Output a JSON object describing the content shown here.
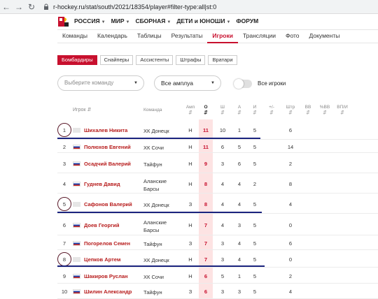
{
  "browser": {
    "url": "r-hockey.ru/stat/south/2021/18354/player#filter-type:all|st:0",
    "back_icon": "arrow-left-icon",
    "forward_icon": "arrow-right-icon",
    "reload_icon": "reload-icon"
  },
  "top_menu": [
    {
      "label": "РОССИЯ",
      "caret": true
    },
    {
      "label": "МИР",
      "caret": true
    },
    {
      "label": "СБОРНАЯ",
      "caret": true
    },
    {
      "label": "ДЕТИ и ЮНОШИ",
      "caret": true
    },
    {
      "label": "ФОРУМ",
      "caret": false
    }
  ],
  "sub_nav": [
    "Команды",
    "Календарь",
    "Таблицы",
    "Результаты",
    "Игроки",
    "Трансляции",
    "Фото",
    "Документы"
  ],
  "sub_nav_active": "Игроки",
  "filter_tabs": [
    "Бомбардиры",
    "Снайперы",
    "Ассистенты",
    "Штрафы",
    "Вратари"
  ],
  "filter_tab_active": "Бомбардиры",
  "team_select": {
    "placeholder": "Выберите команду"
  },
  "amplua_select": {
    "value": "Все амплуа"
  },
  "toggle_label": "Все игроки",
  "table": {
    "headers": {
      "player": "Игрок",
      "team": "Команда",
      "amp": "Амп",
      "o": "О",
      "sh": "Ш",
      "a": "А",
      "i": "И",
      "pm": "+/-",
      "shtr": "Штр",
      "vv": "ВВ",
      "pct_vv": "%ВВ",
      "vpi": "ВП/И"
    },
    "rows": [
      {
        "n": "1",
        "flag": "blank",
        "name": "Шихалев Никита",
        "team": "ХК Донецк",
        "amp": "Н",
        "o": "11",
        "sh": "10",
        "a": "1",
        "i": "5",
        "shtr": "6"
      },
      {
        "n": "2",
        "flag": "ru",
        "name": "Полюхов Евгений",
        "team": "ХК Сочи",
        "amp": "Н",
        "o": "11",
        "sh": "6",
        "a": "5",
        "i": "5",
        "shtr": "14"
      },
      {
        "n": "3",
        "flag": "ru",
        "name": "Осадчий Валерий",
        "team": "Тайфун",
        "amp": "Н",
        "o": "9",
        "sh": "3",
        "a": "6",
        "i": "5",
        "shtr": "2"
      },
      {
        "n": "4",
        "flag": "ru",
        "name": "Гуднев Давид",
        "team": "Аланские Барсы",
        "amp": "Н",
        "o": "8",
        "sh": "4",
        "a": "4",
        "i": "2",
        "shtr": "8"
      },
      {
        "n": "5",
        "flag": "blank",
        "name": "Сафонов Валерий",
        "team": "ХК Донецк",
        "amp": "З",
        "o": "8",
        "sh": "4",
        "a": "4",
        "i": "5",
        "shtr": "4"
      },
      {
        "n": "6",
        "flag": "ru",
        "name": "Доев Георгий",
        "team": "Аланские Барсы",
        "amp": "Н",
        "o": "7",
        "sh": "4",
        "a": "3",
        "i": "5",
        "shtr": "0"
      },
      {
        "n": "7",
        "flag": "ru",
        "name": "Погорелов Семен",
        "team": "Тайфун",
        "amp": "З",
        "o": "7",
        "sh": "3",
        "a": "4",
        "i": "5",
        "shtr": "6"
      },
      {
        "n": "8",
        "flag": "blank",
        "name": "Цепков Артем",
        "team": "ХК Донецк",
        "amp": "Н",
        "o": "7",
        "sh": "3",
        "a": "4",
        "i": "5",
        "shtr": "0"
      },
      {
        "n": "9",
        "flag": "ru",
        "name": "Шакиров Руслан",
        "team": "ХК Сочи",
        "amp": "Н",
        "o": "6",
        "sh": "5",
        "a": "1",
        "i": "5",
        "shtr": "2"
      },
      {
        "n": "10",
        "flag": "ru",
        "name": "Шилин Александр",
        "team": "Тайфун",
        "amp": "З",
        "o": "6",
        "sh": "3",
        "a": "3",
        "i": "5",
        "shtr": "4"
      }
    ]
  },
  "colors": {
    "accent": "#c8102e",
    "annotation_line": "#1a237e",
    "annotation_circle": "#5a1a2a"
  }
}
